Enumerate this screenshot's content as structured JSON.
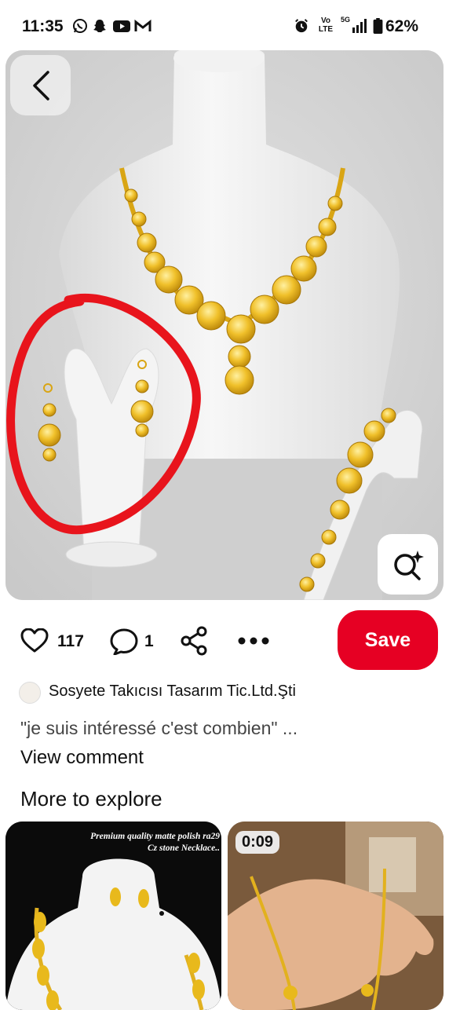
{
  "status_bar": {
    "time": "11:35",
    "battery": "62%",
    "network_1": "Vo LTE",
    "network_2": "5G",
    "icons": [
      "whatsapp-icon",
      "snapchat-icon",
      "youtube-icon",
      "gmail-icon",
      "alarm-icon",
      "signal-icon",
      "battery-icon"
    ]
  },
  "pin": {
    "likes": "117",
    "comments": "1",
    "save_label": "Save",
    "creator_name": "Sosyete Takıcısı Tasarım Tic.Ltd.Şti",
    "comment_preview": "\"je suis intéressé c'est combien\" ...",
    "view_comment": "View comment"
  },
  "explore": {
    "heading": "More to explore",
    "tiles": [
      {
        "caption_line1": "Premium quality matte polish ra29",
        "caption_line2": "Cz stone Necklace.."
      },
      {
        "duration": "0:09"
      }
    ]
  },
  "colors": {
    "accent": "#e60023",
    "gold": "#e8b91c",
    "highlight_circle": "#e8141c"
  }
}
